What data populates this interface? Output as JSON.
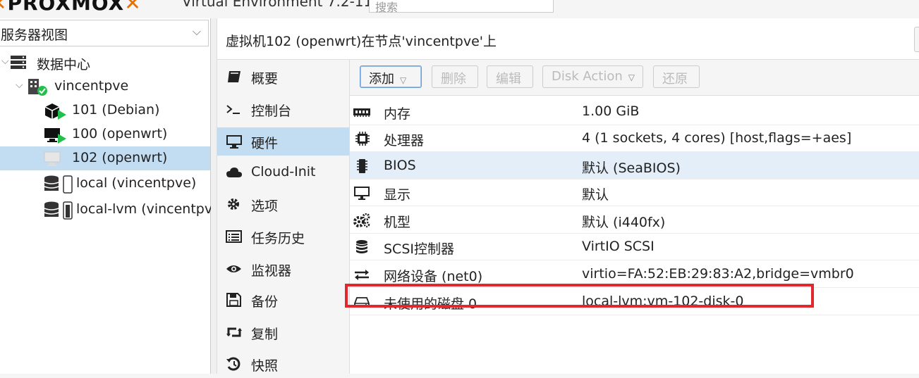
{
  "header": {
    "logo_text": "PROXMOX",
    "product": "Virtual Environment 7.2-11",
    "search_placeholder": "搜索"
  },
  "left": {
    "view_label": "服务器视图",
    "tree": [
      {
        "label": "数据中心"
      },
      {
        "label": "vincentpve"
      },
      {
        "label": "101 (Debian)"
      },
      {
        "label": "100 (openwrt)"
      },
      {
        "label": "102 (openwrt)"
      },
      {
        "label": "local (vincentpve)"
      },
      {
        "label": "local-lvm (vincentpve"
      }
    ]
  },
  "main": {
    "title": "虚拟机102 (openwrt)在节点'vincentpve'上"
  },
  "nav": [
    {
      "label": "概要",
      "icon": "book-icon"
    },
    {
      "label": "控制台",
      "icon": "terminal-icon"
    },
    {
      "label": "硬件",
      "icon": "monitor-icon"
    },
    {
      "label": "Cloud-Init",
      "icon": "cloud-icon"
    },
    {
      "label": "选项",
      "icon": "gear-icon"
    },
    {
      "label": "任务历史",
      "icon": "list-icon"
    },
    {
      "label": "监视器",
      "icon": "eye-icon"
    },
    {
      "label": "备份",
      "icon": "floppy-icon"
    },
    {
      "label": "复制",
      "icon": "retweet-icon"
    },
    {
      "label": "快照",
      "icon": "history-icon"
    }
  ],
  "toolbar": {
    "add": "添加",
    "remove": "删除",
    "edit": "编辑",
    "disk_action": "Disk Action",
    "revert": "还原"
  },
  "hardware": [
    {
      "name": "内存",
      "value": "1.00 GiB",
      "icon": "memory-icon"
    },
    {
      "name": "处理器",
      "value": "4 (1 sockets, 4 cores) [host,flags=+aes]",
      "icon": "cpu-icon"
    },
    {
      "name": "BIOS",
      "value": "默认 (SeaBIOS)",
      "icon": "microchip-icon"
    },
    {
      "name": "显示",
      "value": "默认",
      "icon": "desktop-icon"
    },
    {
      "name": "机型",
      "value": "默认 (i440fx)",
      "icon": "cogs-icon"
    },
    {
      "name": "SCSI控制器",
      "value": "VirtIO SCSI",
      "icon": "database-icon"
    },
    {
      "name": "网络设备 (net0)",
      "value": "virtio=FA:52:EB:29:83:A2,bridge=vmbr0",
      "icon": "exchange-icon"
    },
    {
      "name": "未使用的磁盘 0",
      "value": "local-lvm:vm-102-disk-0",
      "icon": "hdd-icon"
    }
  ],
  "colors": {
    "accent": "#e57000",
    "selection": "#c2dcf2",
    "highlight_box": "#e0282e",
    "running_green": "#21bf4b"
  }
}
